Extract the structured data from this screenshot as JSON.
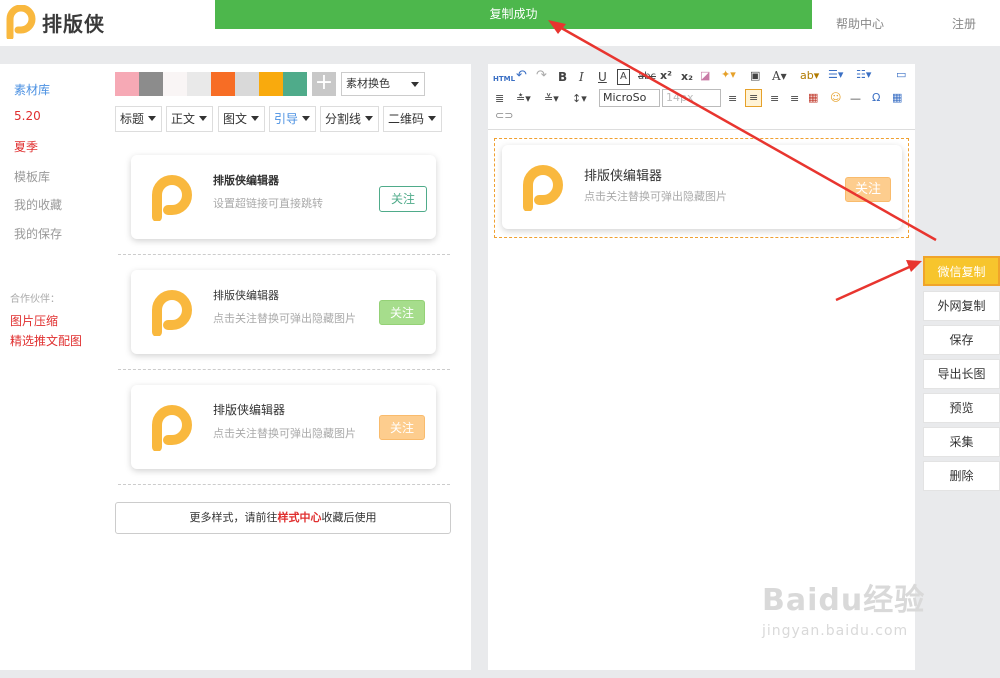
{
  "app": {
    "name": "排版侠"
  },
  "toast": {
    "text": "复制成功"
  },
  "topnav": {
    "help": "帮助中心",
    "register": "注册"
  },
  "sidebar": {
    "items": [
      {
        "label": "素材库",
        "state": "active"
      },
      {
        "label": "5.20",
        "state": "red"
      },
      {
        "label": "夏季",
        "state": "red"
      },
      {
        "label": "模板库",
        "state": "normal"
      },
      {
        "label": "我的收藏",
        "state": "normal"
      },
      {
        "label": "我的保存",
        "state": "normal"
      }
    ],
    "partners_label": "合作伙伴：",
    "partners": [
      "图片压缩",
      "精选推文配图"
    ]
  },
  "library": {
    "swatches": [
      "#f6a9b5",
      "#8c8c8c",
      "#f9f5f5",
      "#e9e9e9",
      "#f76d25",
      "#d9d9d9",
      "#f9aa0d",
      "#4fab8a"
    ],
    "color_select": "素材换色",
    "tabs": [
      {
        "label": "标题",
        "active": false
      },
      {
        "label": "正文",
        "active": false
      },
      {
        "label": "图文",
        "active": false
      },
      {
        "label": "引导",
        "active": true
      },
      {
        "label": "分割线",
        "active": false
      },
      {
        "label": "二维码",
        "active": false
      }
    ],
    "cards": [
      {
        "title": "排版侠编辑器",
        "subtitle": "设置超链接可直接跳转",
        "follow": "关注",
        "style": "outline"
      },
      {
        "title": "排版侠编辑器",
        "subtitle": "点击关注替换可弹出隐藏图片",
        "follow": "关注",
        "style": "green"
      },
      {
        "title": "排版侠编辑器",
        "subtitle": "点击关注替换可弹出隐藏图片",
        "follow": "关注",
        "style": "orange"
      }
    ],
    "more": {
      "prefix": "更多样式，请前往",
      "link": "样式中心",
      "suffix": "收藏后使用"
    }
  },
  "editor": {
    "font_family": "MicroSo",
    "font_size": "14px",
    "html_label": "HTML",
    "content_card": {
      "title": "排版侠编辑器",
      "subtitle": "点击关注替换可弹出隐藏图片",
      "follow": "关注"
    }
  },
  "actions": [
    "微信复制",
    "外网复制",
    "保存",
    "导出长图",
    "预览",
    "采集",
    "删除"
  ],
  "watermark": {
    "brand": "Baidu经验",
    "url": "jingyan.baidu.com"
  },
  "colors": {
    "accent": "#f9b83e",
    "toast": "#4db74c",
    "primary_action": "#f7c52d",
    "link_red": "#e03030",
    "active_blue": "#4a90e2"
  }
}
